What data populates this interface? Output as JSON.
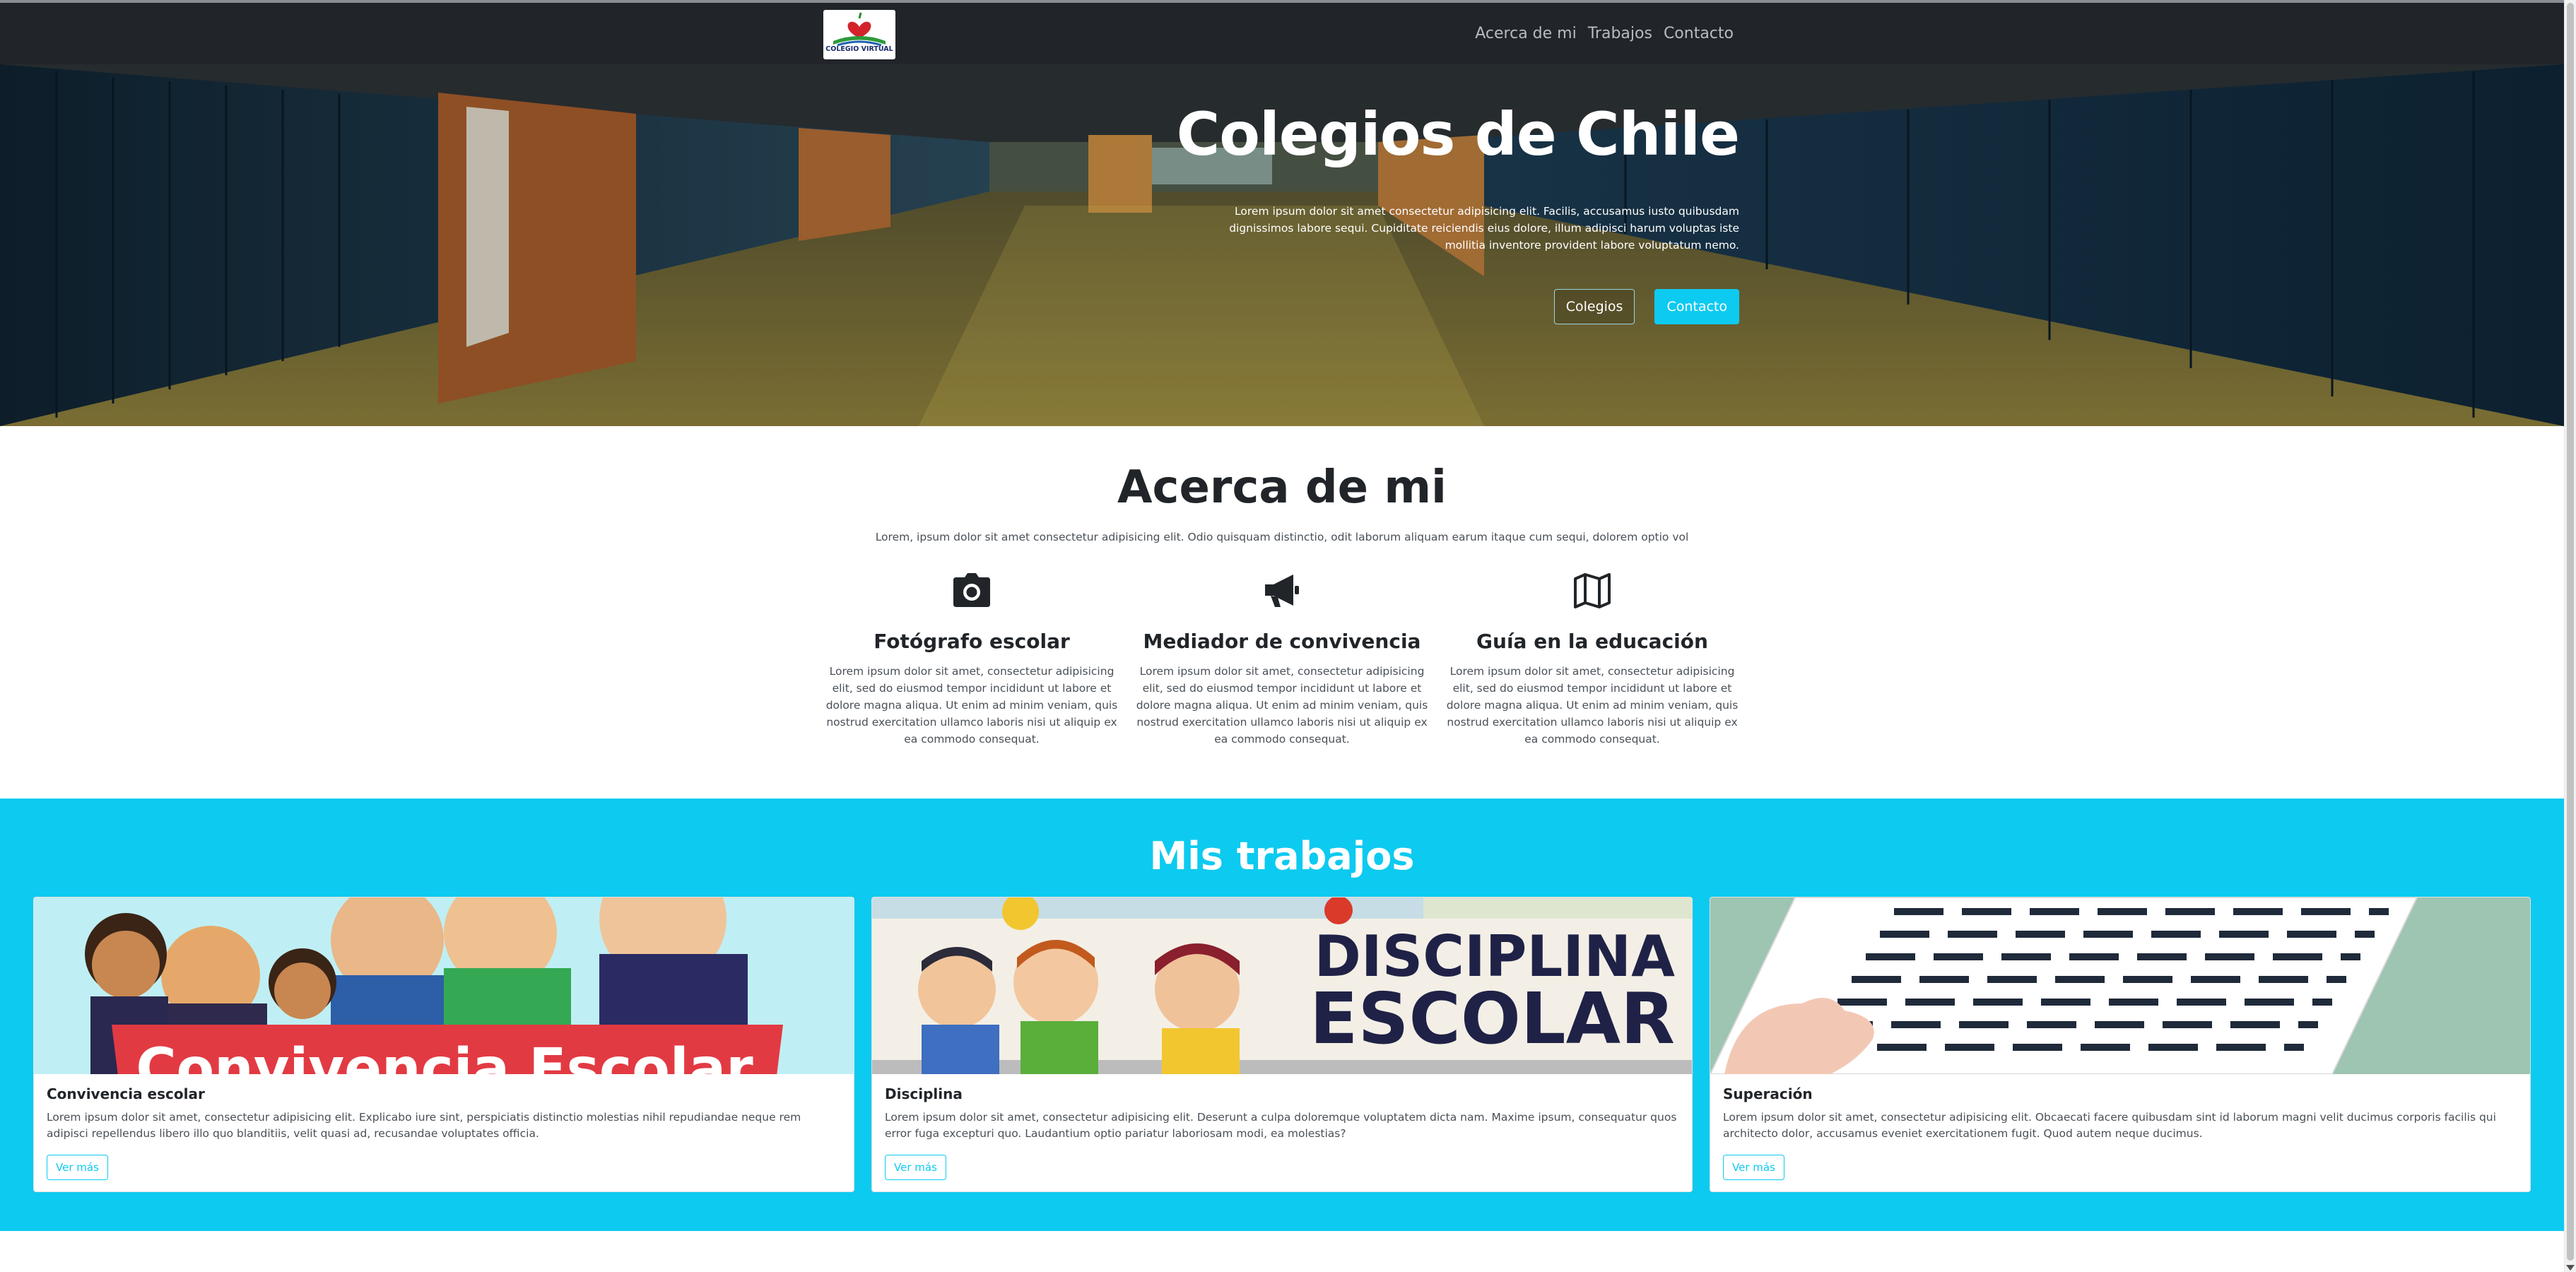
{
  "navbar": {
    "logo_text": "COLEGIO VIRTUAL",
    "links": [
      "Acerca de mi",
      "Trabajos",
      "Contacto"
    ]
  },
  "hero": {
    "title": "Colegios de Chile",
    "text": "Lorem ipsum dolor sit amet consectetur adipisicing elit. Facilis, accusamus iusto quibusdam dignissimos labore sequi. Cupiditate reiciendis eius dolore, illum adipisci harum voluptas iste mollitia inventore provident labore voluptatum nemo.",
    "btn_colegios": "Colegios",
    "btn_contacto": "Contacto"
  },
  "about": {
    "title": "Acerca de mi",
    "subtitle": "Lorem, ipsum dolor sit amet consectetur adipisicing elit. Odio quisquam distinctio, odit laborum aliquam earum itaque cum sequi, dolorem optio vol",
    "features": [
      {
        "icon": "camera-icon",
        "title": "Fotógrafo escolar",
        "text": "Lorem ipsum dolor sit amet, consectetur adipisicing elit, sed do eiusmod tempor incididunt ut labore et dolore magna aliqua. Ut enim ad minim veniam, quis nostrud exercitation ullamco laboris nisi ut aliquip ex ea commodo consequat."
      },
      {
        "icon": "megaphone-icon",
        "title": "Mediador de convivencia",
        "text": "Lorem ipsum dolor sit amet, consectetur adipisicing elit, sed do eiusmod tempor incididunt ut labore et dolore magna aliqua. Ut enim ad minim veniam, quis nostrud exercitation ullamco laboris nisi ut aliquip ex ea commodo consequat."
      },
      {
        "icon": "map-icon",
        "title": "Guía en la educación",
        "text": "Lorem ipsum dolor sit amet, consectetur adipisicing elit, sed do eiusmod tempor incididunt ut labore et dolore magna aliqua. Ut enim ad minim veniam, quis nostrud exercitation ullamco laboris nisi ut aliquip ex ea commodo consequat."
      }
    ]
  },
  "works": {
    "title": "Mis trabajos",
    "cards": [
      {
        "image_text": "Convivencia Escolar",
        "title": "Convivencia escolar",
        "text": "Lorem ipsum dolor sit amet, consectetur adipisicing elit. Explicabo iure sint, perspiciatis distinctio molestias nihil repudiandae neque rem adipisci repellendus libero illo quo blanditiis, velit quasi ad, recusandae voluptates officia.",
        "button": "Ver más"
      },
      {
        "image_text_1": "DISCIPLINA",
        "image_text_2": "ESCOLAR",
        "title": "Disciplina",
        "text": "Lorem ipsum dolor sit amet, consectetur adipisicing elit. Deserunt a culpa doloremque voluptatem dicta nam. Maxime ipsum, consequatur quos error fuga excepturi quo. Laudantium optio pariatur laboriosam modi, ea molestias?",
        "button": "Ver más"
      },
      {
        "title": "Superación",
        "text": "Lorem ipsum dolor sit amet, consectetur adipisicing elit. Obcaecati facere quibusdam sint id laborum magni velit ducimus corporis facilis qui architecto dolor, accusamus eveniet exercitationem fugit. Quod autem neque ducimus.",
        "button": "Ver más"
      }
    ]
  },
  "colors": {
    "navbar": "#212529",
    "accent": "#0dcaf0",
    "text_dark": "#212529"
  }
}
